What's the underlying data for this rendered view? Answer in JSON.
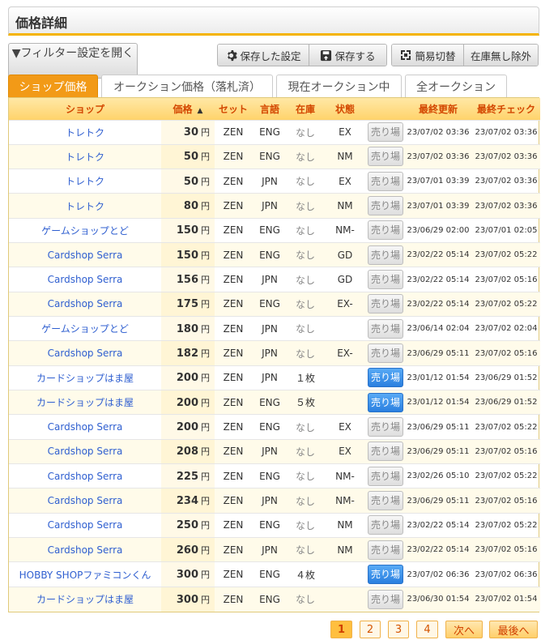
{
  "header": {
    "title": "価格詳細"
  },
  "toolbar": {
    "filter_label": "▼フィルター設定を開く",
    "saved_settings_label": "保存した設定",
    "save_label": "保存する",
    "simple_switch_label": "簡易切替",
    "exclude_no_stock_label": "在庫無し除外"
  },
  "tabs": [
    {
      "label": "ショップ価格",
      "active": true
    },
    {
      "label": "オークション価格（落札済）",
      "active": false
    },
    {
      "label": "現在オークション中",
      "active": false
    },
    {
      "label": "全オークション",
      "active": false
    }
  ],
  "table": {
    "columns": {
      "shop": "ショップ",
      "price": "価格",
      "sort_indicator": "▲",
      "set": "セット",
      "lang": "言語",
      "stock": "在庫",
      "condition": "状態",
      "updated": "最終更新",
      "checked": "最終チェック"
    },
    "currency": "円",
    "sell_label": "売り場",
    "rows": [
      {
        "shop": "トレトク",
        "price": "30",
        "set": "ZEN",
        "lang": "ENG",
        "stock": "なし",
        "condition": "EX",
        "sell_active": false,
        "updated": "23/07/02 03:36",
        "checked": "23/07/02 03:36"
      },
      {
        "shop": "トレトク",
        "price": "50",
        "set": "ZEN",
        "lang": "ENG",
        "stock": "なし",
        "condition": "NM",
        "sell_active": false,
        "updated": "23/07/02 03:36",
        "checked": "23/07/02 03:36"
      },
      {
        "shop": "トレトク",
        "price": "50",
        "set": "ZEN",
        "lang": "JPN",
        "stock": "なし",
        "condition": "EX",
        "sell_active": false,
        "updated": "23/07/01 03:39",
        "checked": "23/07/02 03:36"
      },
      {
        "shop": "トレトク",
        "price": "80",
        "set": "ZEN",
        "lang": "JPN",
        "stock": "なし",
        "condition": "NM",
        "sell_active": false,
        "updated": "23/07/01 03:39",
        "checked": "23/07/02 03:36"
      },
      {
        "shop": "ゲームショップとど",
        "price": "150",
        "set": "ZEN",
        "lang": "ENG",
        "stock": "なし",
        "condition": "NM-",
        "sell_active": false,
        "updated": "23/06/29 02:00",
        "checked": "23/07/01 02:05"
      },
      {
        "shop": "Cardshop Serra",
        "price": "150",
        "set": "ZEN",
        "lang": "ENG",
        "stock": "なし",
        "condition": "GD",
        "sell_active": false,
        "updated": "23/02/22 05:14",
        "checked": "23/07/02 05:22"
      },
      {
        "shop": "Cardshop Serra",
        "price": "156",
        "set": "ZEN",
        "lang": "JPN",
        "stock": "なし",
        "condition": "GD",
        "sell_active": false,
        "updated": "23/02/22 05:14",
        "checked": "23/07/02 05:16"
      },
      {
        "shop": "Cardshop Serra",
        "price": "175",
        "set": "ZEN",
        "lang": "ENG",
        "stock": "なし",
        "condition": "EX-",
        "sell_active": false,
        "updated": "23/02/22 05:14",
        "checked": "23/07/02 05:22"
      },
      {
        "shop": "ゲームショップとど",
        "price": "180",
        "set": "ZEN",
        "lang": "JPN",
        "stock": "なし",
        "condition": "",
        "sell_active": false,
        "updated": "23/06/14 02:04",
        "checked": "23/07/02 02:04"
      },
      {
        "shop": "Cardshop Serra",
        "price": "182",
        "set": "ZEN",
        "lang": "JPN",
        "stock": "なし",
        "condition": "EX-",
        "sell_active": false,
        "updated": "23/06/29 05:11",
        "checked": "23/07/02 05:16"
      },
      {
        "shop": "カードショップはま屋",
        "price": "200",
        "set": "ZEN",
        "lang": "JPN",
        "stock": "１枚",
        "condition": "",
        "sell_active": true,
        "updated": "23/01/12 01:54",
        "checked": "23/06/29 01:52"
      },
      {
        "shop": "カードショップはま屋",
        "price": "200",
        "set": "ZEN",
        "lang": "ENG",
        "stock": "５枚",
        "condition": "",
        "sell_active": true,
        "updated": "23/01/12 01:54",
        "checked": "23/06/29 01:52"
      },
      {
        "shop": "Cardshop Serra",
        "price": "200",
        "set": "ZEN",
        "lang": "ENG",
        "stock": "なし",
        "condition": "EX",
        "sell_active": false,
        "updated": "23/06/29 05:11",
        "checked": "23/07/02 05:22"
      },
      {
        "shop": "Cardshop Serra",
        "price": "208",
        "set": "ZEN",
        "lang": "JPN",
        "stock": "なし",
        "condition": "EX",
        "sell_active": false,
        "updated": "23/06/29 05:11",
        "checked": "23/07/02 05:16"
      },
      {
        "shop": "Cardshop Serra",
        "price": "225",
        "set": "ZEN",
        "lang": "ENG",
        "stock": "なし",
        "condition": "NM-",
        "sell_active": false,
        "updated": "23/02/26 05:10",
        "checked": "23/07/02 05:22"
      },
      {
        "shop": "Cardshop Serra",
        "price": "234",
        "set": "ZEN",
        "lang": "JPN",
        "stock": "なし",
        "condition": "NM-",
        "sell_active": false,
        "updated": "23/06/29 05:11",
        "checked": "23/07/02 05:16"
      },
      {
        "shop": "Cardshop Serra",
        "price": "250",
        "set": "ZEN",
        "lang": "ENG",
        "stock": "なし",
        "condition": "NM",
        "sell_active": false,
        "updated": "23/02/22 05:14",
        "checked": "23/07/02 05:22"
      },
      {
        "shop": "Cardshop Serra",
        "price": "260",
        "set": "ZEN",
        "lang": "JPN",
        "stock": "なし",
        "condition": "NM",
        "sell_active": false,
        "updated": "23/02/22 05:14",
        "checked": "23/07/02 05:16"
      },
      {
        "shop": "HOBBY SHOPファミコンくん",
        "price": "300",
        "set": "ZEN",
        "lang": "ENG",
        "stock": "４枚",
        "condition": "",
        "sell_active": true,
        "updated": "23/07/02 06:36",
        "checked": "23/07/02 06:36"
      },
      {
        "shop": "カードショップはま屋",
        "price": "300",
        "set": "ZEN",
        "lang": "ENG",
        "stock": "なし",
        "condition": "",
        "sell_active": false,
        "updated": "23/06/30 01:54",
        "checked": "23/07/02 01:54"
      }
    ]
  },
  "pagination": {
    "pages": [
      "1",
      "2",
      "3",
      "4"
    ],
    "current": "1",
    "next_label": "次へ",
    "last_label": "最後へ"
  }
}
